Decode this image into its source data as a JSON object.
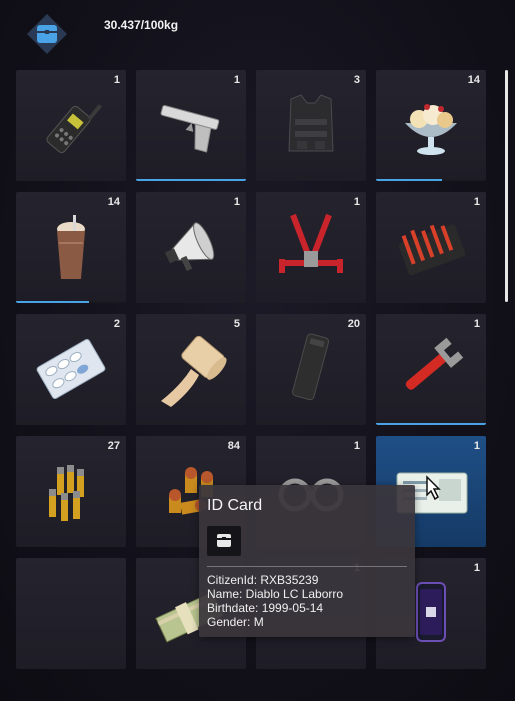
{
  "header": {
    "weight_text": "30.437/100kg",
    "icon": "inventory-box-icon"
  },
  "slots": [
    {
      "count": "1",
      "item": "walkie-talkie-icon"
    },
    {
      "count": "1",
      "item": "pistol-icon",
      "durability": 1.0
    },
    {
      "count": "3",
      "item": "armor-vest-icon"
    },
    {
      "count": "14",
      "item": "ice-cream-sundae-icon",
      "durability": 0.6
    },
    {
      "count": "14",
      "item": "milkshake-icon",
      "durability": 0.66
    },
    {
      "count": "1",
      "item": "megaphone-icon"
    },
    {
      "count": "1",
      "item": "harness-icon"
    },
    {
      "count": "1",
      "item": "toolkit-icon"
    },
    {
      "count": "2",
      "item": "pill-pack-icon"
    },
    {
      "count": "5",
      "item": "bandage-roll-icon"
    },
    {
      "count": "20",
      "item": "magazine-icon"
    },
    {
      "count": "1",
      "item": "pipe-wrench-icon",
      "durability": 1.0
    },
    {
      "count": "27",
      "item": "rifle-ammo-icon"
    },
    {
      "count": "84",
      "item": "pistol-ammo-icon"
    },
    {
      "count": "1",
      "item": "handcuffs-icon"
    },
    {
      "count": "1",
      "item": "id-card-icon",
      "selected": true
    },
    {
      "count": "",
      "item": ""
    },
    {
      "count": "",
      "item": "cash-stack-icon"
    },
    {
      "count": "1",
      "item": "unknown-item-icon"
    },
    {
      "count": "1",
      "item": "phone-icon"
    }
  ],
  "tooltip": {
    "title": "ID Card",
    "icon": "box-icon",
    "lines": {
      "citizen": "CitizenId: RXB35239",
      "name": "Name: Diablo LC Laborro",
      "birthdate": "Birthdate: 1999-05-14",
      "gender": "Gender: M"
    }
  },
  "colors": {
    "accent": "#4aa3e6",
    "selected_slot": "#1f4f86",
    "background": "#121019"
  }
}
